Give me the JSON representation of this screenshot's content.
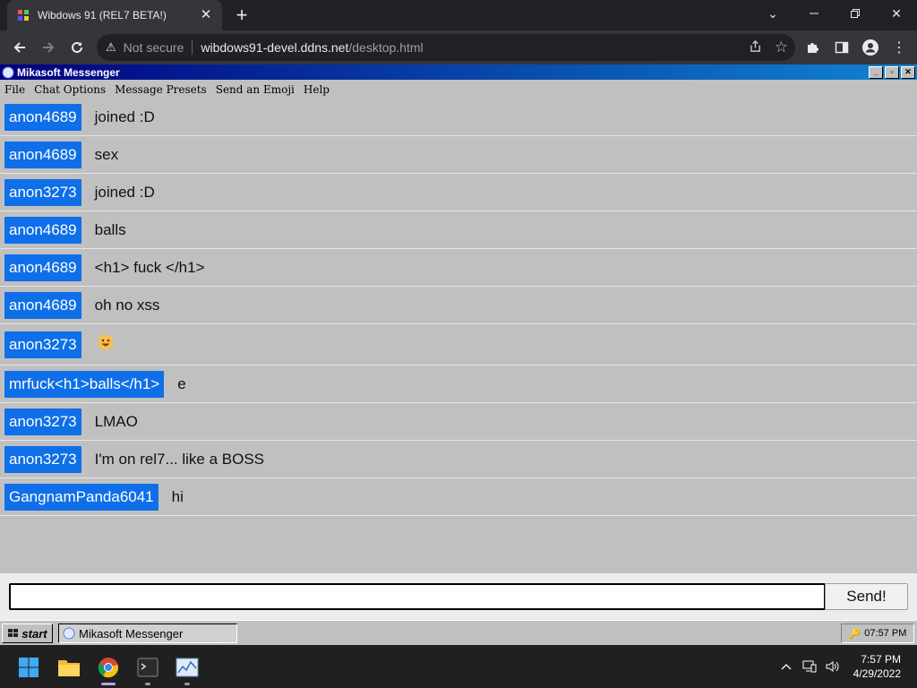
{
  "browser": {
    "tab_title": "Wibdows 91 (REL7 BETA!)",
    "security_label": "Not secure",
    "url_host": "wibdows91-devel.ddns.net",
    "url_path": "/desktop.html"
  },
  "window": {
    "title": "Mikasoft Messenger",
    "menu": [
      "File",
      "Chat Options",
      "Message Presets",
      "Send an Emoji",
      "Help"
    ]
  },
  "messages": [
    {
      "user": "anon4689",
      "text": "joined :D"
    },
    {
      "user": "anon4689",
      "text": "sex"
    },
    {
      "user": "anon3273",
      "text": "joined :D"
    },
    {
      "user": "anon4689",
      "text": "balls"
    },
    {
      "user": "anon4689",
      "text": "<h1> fuck </h1>"
    },
    {
      "user": "anon4689",
      "text": "oh no xss"
    },
    {
      "user": "anon3273",
      "text": "",
      "emoji": "grinning-face-emoji"
    },
    {
      "user": "mrfuck<h1>balls</h1>",
      "text": "e"
    },
    {
      "user": "anon3273",
      "text": "LMAO"
    },
    {
      "user": "anon3273",
      "text": "I'm on rel7... like a BOSS"
    },
    {
      "user": "GangnamPanda6041",
      "text": "hi"
    }
  ],
  "composer": {
    "value": "",
    "send_label": "Send!"
  },
  "w91_taskbar": {
    "start_label": "start",
    "task_label": "Mikasoft Messenger",
    "tray_time": "07:57 PM"
  },
  "win_taskbar": {
    "time": "7:57 PM",
    "date": "4/29/2022"
  },
  "colors": {
    "username_badge": "#0f6fe8",
    "titlebar_start": "#000080",
    "titlebar_end": "#1084d0"
  }
}
